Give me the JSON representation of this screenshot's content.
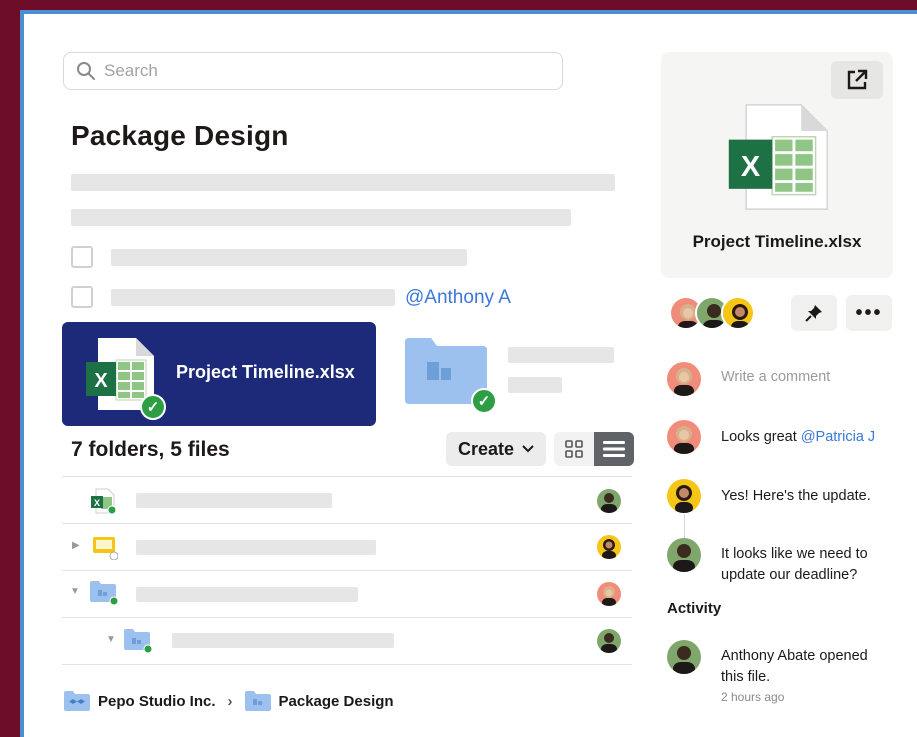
{
  "search": {
    "placeholder": "Search"
  },
  "page": {
    "title": "Package Design",
    "mention": "@Anthony A"
  },
  "featured_file": {
    "name": "Project Timeline.xlsx"
  },
  "listing": {
    "count_label": "7 folders, 5 files",
    "create_label": "Create",
    "view_modes": [
      "grid-icon",
      "list-icon"
    ],
    "active_view": "list-icon"
  },
  "breadcrumb": {
    "items": [
      "Pepo Studio Inc.",
      "Package Design"
    ],
    "separator": "›"
  },
  "preview": {
    "file_name": "Project Timeline.xlsx",
    "open_icon": "external-link-icon"
  },
  "actions": {
    "pin_icon": "pin-icon",
    "more_label": "•••"
  },
  "comments": {
    "input_placeholder": "Write a comment",
    "items": [
      {
        "text": "Looks great ",
        "mention": "@Patricia J"
      },
      {
        "text": "Yes! Here's the update."
      },
      {
        "line1": "It looks like we need to",
        "line2": "update our deadline?"
      }
    ]
  },
  "activity": {
    "title": "Activity",
    "line1": "Anthony Abate opened",
    "line2": "this file.",
    "time": "2 hours ago"
  },
  "colors": {
    "background": "#6d0d2a",
    "frame": "#4a8fd0",
    "card_navy": "#1c2a79",
    "excel_green": "#1e7145",
    "check_green": "#2e9e44",
    "link_blue": "#3b78d8",
    "folder_blue": "#9cc1ef"
  }
}
